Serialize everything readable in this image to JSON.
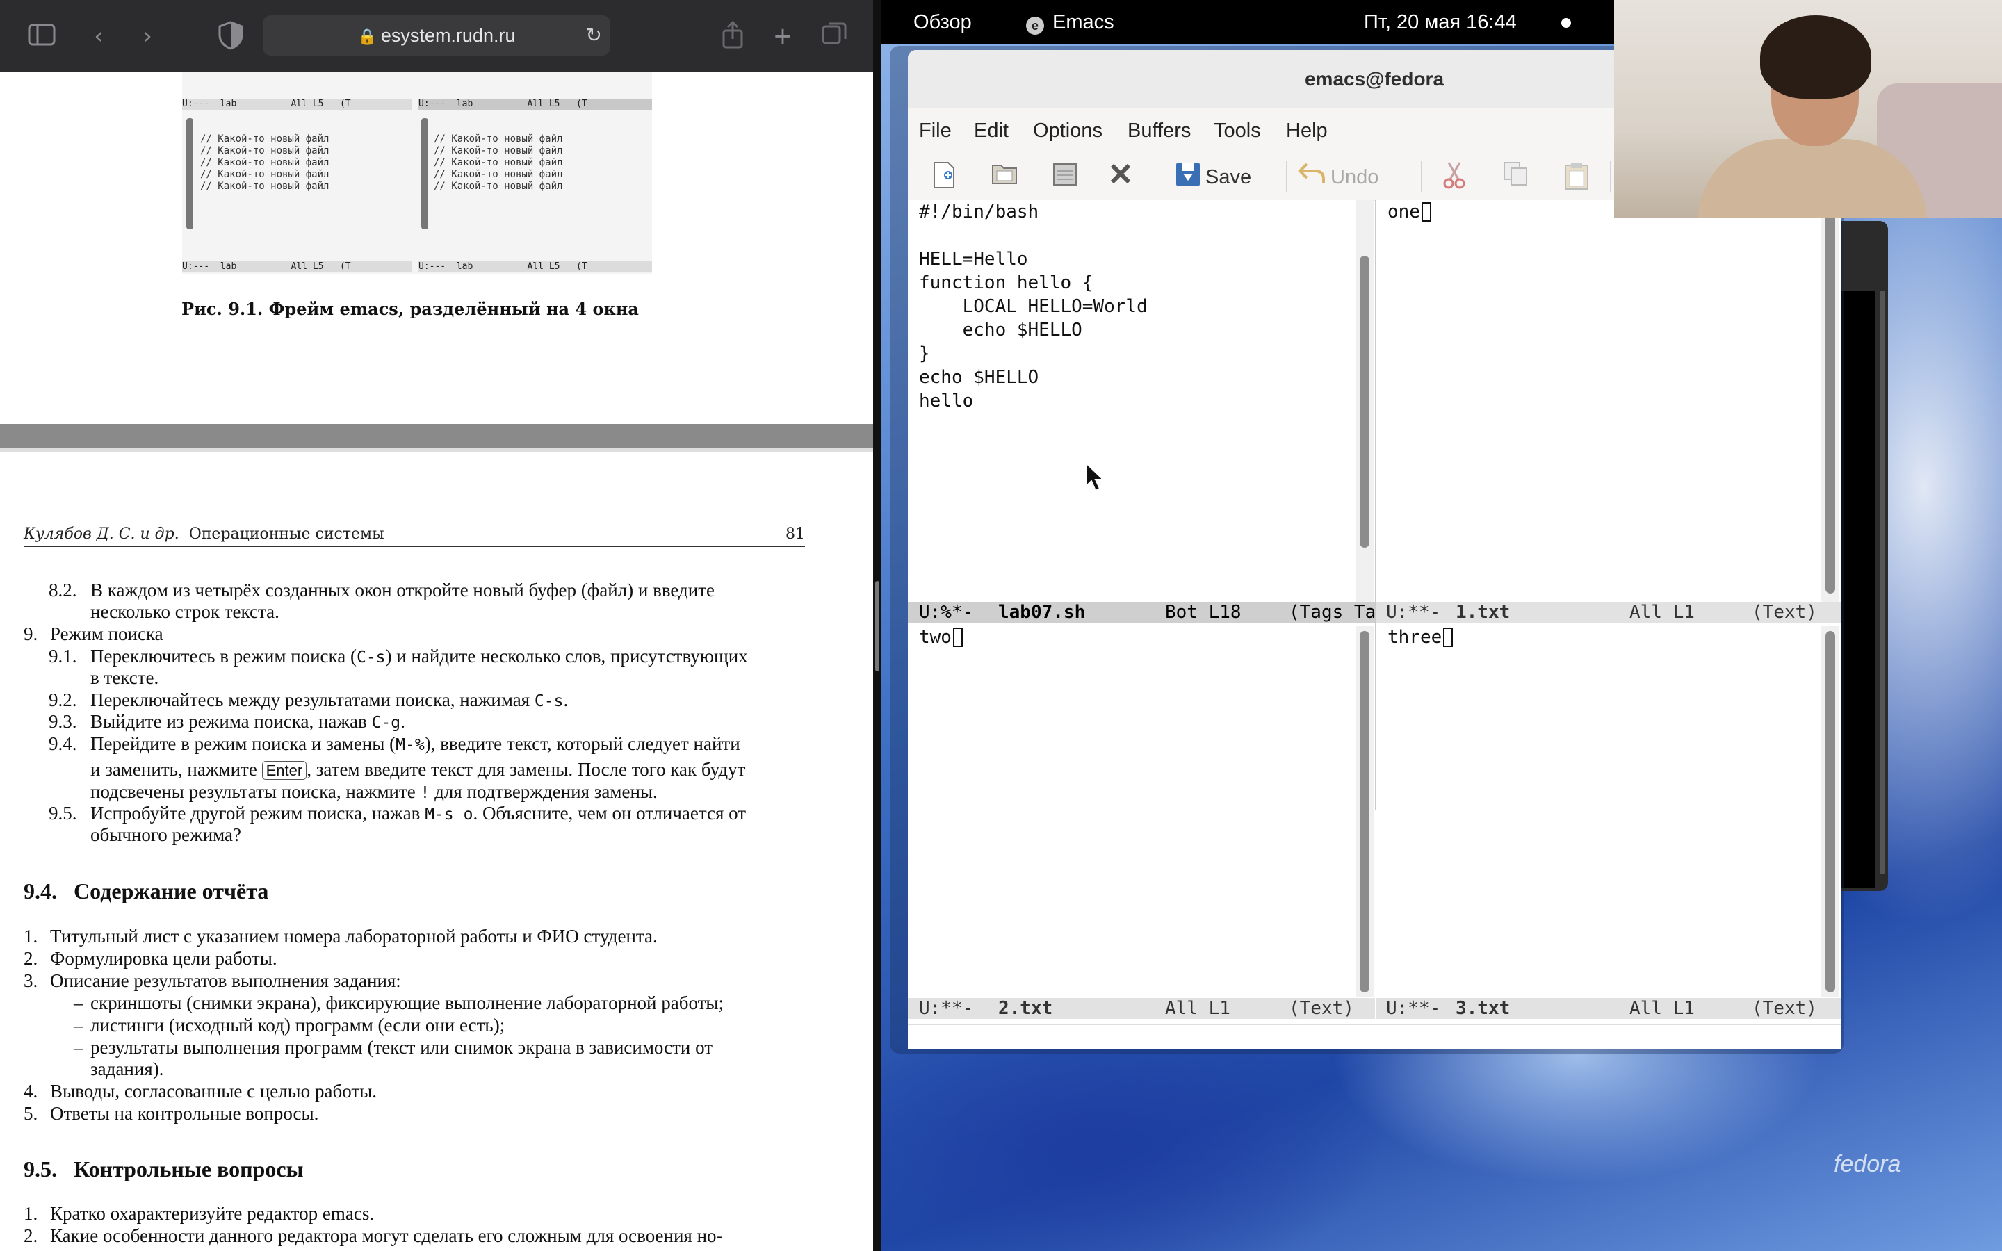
{
  "browser": {
    "url": "esystem.rudn.ru",
    "figure": {
      "mode_left": "U:---  lab          All L5   (T",
      "mode_right": "U:---  lab          All L5   (T",
      "line": "// Какой-то новый файл",
      "caption": "Рис. 9.1. Фрейм emacs, разделённый на 4 окна"
    },
    "running_head": {
      "authors": "Кулябов Д. С. и др.",
      "title": "Операционные системы",
      "page": "81"
    },
    "items": [
      {
        "num": "8.2.",
        "text": "В каждом из четырёх созданных окон откройте новый буфер (файл) и введите",
        "cont": "несколько строк текста."
      },
      {
        "num": "9.",
        "text": "Режим поиска"
      },
      {
        "num": "9.1.",
        "text_a": "Переключитесь в режим поиска (",
        "code": "C-s",
        "text_b": ") и найдите несколько слов, присутствующих",
        "cont": "в тексте."
      },
      {
        "num": "9.2.",
        "text_a": "Переключайтесь между результатами поиска, нажимая ",
        "code": "C-s",
        "text_b": "."
      },
      {
        "num": "9.3.",
        "text_a": "Выйдите из режима поиска, нажав ",
        "code": "C-g",
        "text_b": "."
      },
      {
        "num": "9.4.",
        "text_a": "Перейдите в режим поиска и замены (",
        "code": "M-%",
        "text_b": "), введите текст, который следует найти",
        "line2_a": "и заменить, нажмите ",
        "key": "Enter",
        "line2_b": ", затем введите текст для замены. После того как будут",
        "line3_a": "подсвечены результаты поиска, нажмите ",
        "code3": "!",
        "line3_b": " для подтверждения замены."
      },
      {
        "num": "9.5.",
        "text_a": "Испробуйте другой режим поиска, нажав ",
        "code": "M-s o",
        "text_b": ". Объясните, чем он отличается от",
        "cont": "обычного режима?"
      }
    ],
    "section_94": {
      "num": "9.4.",
      "title": "Содержание отчёта"
    },
    "report_items": [
      {
        "num": "1.",
        "text": "Титульный лист с указанием номера лабораторной работы и ФИО студента."
      },
      {
        "num": "2.",
        "text": "Формулировка цели работы."
      },
      {
        "num": "3.",
        "text": "Описание результатов выполнения задания:"
      },
      {
        "num": "–",
        "text": "скриншоты (снимки экрана), фиксирующие выполнение лабораторной работы;"
      },
      {
        "num": "–",
        "text": "листинги (исходный код) программ (если они есть);"
      },
      {
        "num": "–",
        "text": "результаты выполнения программ (текст или снимок экрана в зависимости от",
        "cont": "задания)."
      },
      {
        "num": "4.",
        "text": "Выводы, согласованные с целью работы."
      },
      {
        "num": "5.",
        "text": "Ответы на контрольные вопросы."
      }
    ],
    "section_95": {
      "num": "9.5.",
      "title": "Контрольные вопросы"
    },
    "questions": [
      {
        "num": "1.",
        "text": "Кратко охарактеризуйте редактор emacs."
      },
      {
        "num": "2.",
        "text": "Какие особенности данного редактора могут сделать его сложным для освоения но-"
      }
    ]
  },
  "topbar": {
    "overview": "Обзор",
    "app": "Emacs",
    "clock": "Пт, 20 мая  16:44"
  },
  "emacs": {
    "title": "emacs@fedora",
    "menu": [
      "File",
      "Edit",
      "Options",
      "Buffers",
      "Tools",
      "Help"
    ],
    "toolbar": {
      "save": "Save",
      "undo": "Undo"
    },
    "panes": {
      "tl": {
        "code": "#!/bin/bash\n\nHELL=Hello\nfunction hello {\n    LOCAL HELLO=World\n    echo $HELLO\n}\necho $HELLO\nhello",
        "mode_state": "U:%*-",
        "buffer": "lab07.sh",
        "pos": "Bot L18",
        "modes": "(Tags Ta"
      },
      "tr": {
        "text": "one",
        "mode_state": "U:**-",
        "buffer": "1.txt",
        "pos": "All L1",
        "modes": "(Text)"
      },
      "bl": {
        "text": "two",
        "mode_state": "U:**-",
        "buffer": "2.txt",
        "pos": "All L1",
        "modes": "(Text)"
      },
      "br": {
        "text": "three",
        "mode_state": "U:**-",
        "buffer": "3.txt",
        "pos": "All L1",
        "modes": "(Text)"
      }
    }
  },
  "desktop": {
    "watermark": "fedora"
  },
  "colors": {
    "topbar": "#000000",
    "browser_toolbar": "#2c2c2e",
    "modeline_active": "#cfcfcf",
    "modeline_inactive": "#e2e2e2"
  }
}
